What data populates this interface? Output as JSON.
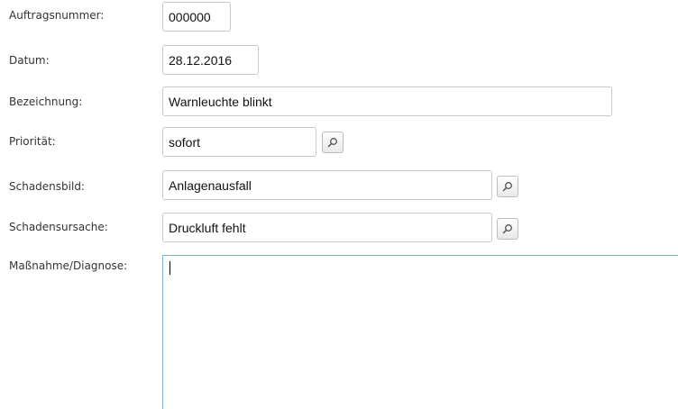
{
  "form": {
    "fields": [
      {
        "key": "auftragsnummer",
        "label": "Auftragsnummer:",
        "value": "000000",
        "lookup": false
      },
      {
        "key": "datum",
        "label": "Datum:",
        "value": "28.12.2016",
        "lookup": false
      },
      {
        "key": "bezeichnung",
        "label": "Bezeichnung:",
        "value": "Warnleuchte blinkt",
        "lookup": false
      },
      {
        "key": "prioritaet",
        "label": "Priorität:",
        "value": "sofort",
        "lookup": true
      },
      {
        "key": "schadensbild",
        "label": "Schadensbild:",
        "value": "Anlagenausfall",
        "lookup": true
      },
      {
        "key": "schadensursache",
        "label": "Schadensursache:",
        "value": "Druckluft fehlt",
        "lookup": true
      }
    ],
    "massnahme": {
      "label": "Maßnahme/Diagnose:",
      "value": ""
    }
  },
  "icons": {
    "lookup": "magnifier-icon"
  }
}
